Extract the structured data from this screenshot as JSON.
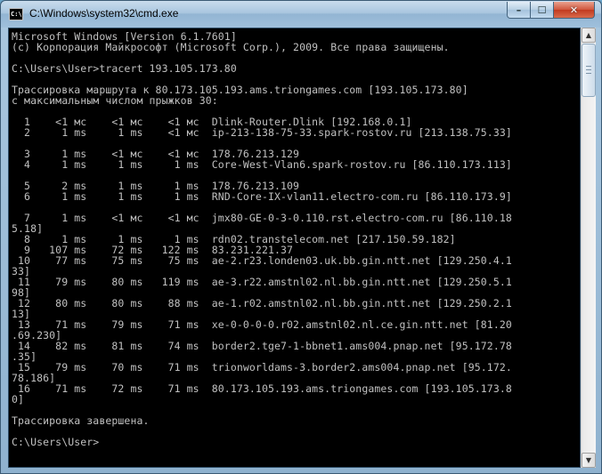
{
  "window": {
    "title": "C:\\Windows\\system32\\cmd.exe",
    "icon_label": "C:\\",
    "controls": {
      "minimize": "–",
      "maximize": "☐",
      "close": "✕"
    }
  },
  "console": {
    "lines": [
      "Microsoft Windows [Version 6.1.7601]",
      "(c) Корпорация Майкрософт (Microsoft Corp.), 2009. Все права защищены.",
      "",
      "C:\\Users\\User>tracert 193.105.173.80",
      "",
      "Трассировка маршрута к 80.173.105.193.ams.triongames.com [193.105.173.80]",
      "с максимальным числом прыжков 30:",
      "",
      "  1    <1 мс    <1 мс    <1 мс  Dlink-Router.Dlink [192.168.0.1]",
      "  2     1 ms     1 ms    <1 мс  ip-213-138-75-33.spark-rostov.ru [213.138.75.33]",
      "",
      "  3     1 ms    <1 мс    <1 мс  178.76.213.129",
      "  4     1 ms     1 ms     1 ms  Core-West-Vlan6.spark-rostov.ru [86.110.173.113]",
      "",
      "  5     2 ms     1 ms     1 ms  178.76.213.109",
      "  6     1 ms     1 ms     1 ms  RND-Core-IX-vlan11.electro-com.ru [86.110.173.9]",
      "",
      "  7     1 ms    <1 мс    <1 мс  jmx80-GE-0-3-0.110.rst.electro-com.ru [86.110.18",
      "5.18]",
      "  8     1 ms     1 ms     1 ms  rdn02.transtelecom.net [217.150.59.182]",
      "  9   107 ms    72 ms   122 ms  83.231.221.37",
      " 10    77 ms    75 ms    75 ms  ae-2.r23.londen03.uk.bb.gin.ntt.net [129.250.4.1",
      "33]",
      " 11    79 ms    80 ms   119 ms  ae-3.r22.amstnl02.nl.bb.gin.ntt.net [129.250.5.1",
      "98]",
      " 12    80 ms    80 ms    88 ms  ae-1.r02.amstnl02.nl.bb.gin.ntt.net [129.250.2.1",
      "13]",
      " 13    71 ms    79 ms    71 ms  xe-0-0-0-0.r02.amstnl02.nl.ce.gin.ntt.net [81.20",
      ".69.230]",
      " 14    82 ms    81 ms    74 ms  border2.tge7-1-bbnet1.ams004.pnap.net [95.172.78",
      ".35]",
      " 15    79 ms    70 ms    71 ms  trionworldams-3.border2.ams004.pnap.net [95.172.",
      "78.186]",
      " 16    71 ms    72 ms    71 ms  80.173.105.193.ams.triongames.com [193.105.173.8",
      "0]",
      "",
      "Трассировка завершена.",
      "",
      "C:\\Users\\User>"
    ]
  },
  "scrollbar": {
    "up": "▲",
    "down": "▼",
    "position_fraction": 0.0
  }
}
